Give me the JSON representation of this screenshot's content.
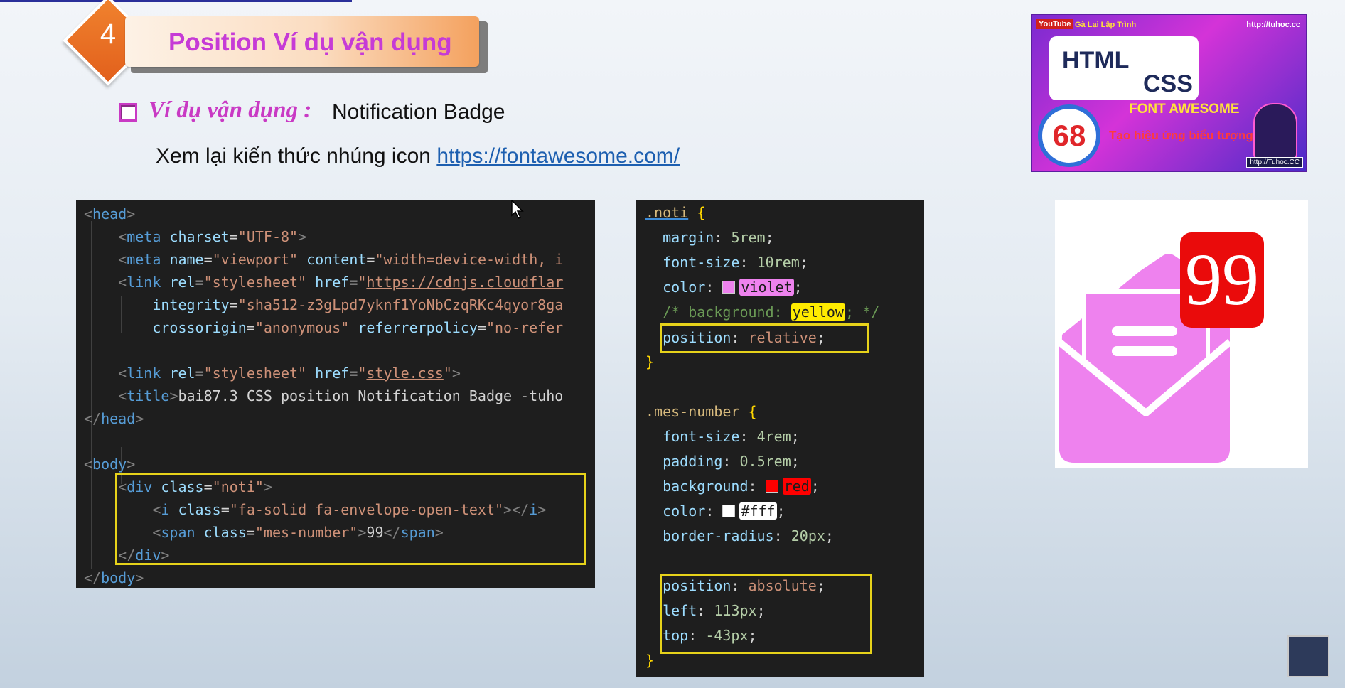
{
  "slide": {
    "number": "4",
    "title": "Position Ví dụ vận dụng",
    "example_label": "Ví dụ vận dụng :",
    "example_value": "Notification Badge",
    "review_text": "Xem lại kiến thức nhúng icon",
    "review_link": "https://fontawesome.com/"
  },
  "thumbnail": {
    "youtube_label": "YouTube",
    "channel_label": "Gà Lại Lập Trình",
    "url_top": "http://tuhoc.cc",
    "html_label": "HTML",
    "css_label": "CSS",
    "episode": "68",
    "fa_title": "FONT AWESOME",
    "subtitle": "Tạo hiệu ứng biểu tượng đẹp",
    "url_bottom": "http://Tuhoc.CC"
  },
  "html_code": {
    "lines": [
      "<head>",
      "    <meta charset=\"UTF-8\">",
      "    <meta name=\"viewport\" content=\"width=device-width, i",
      "    <link rel=\"stylesheet\" href=\"https://cdnjs.cloudflar",
      "        integrity=\"sha512-z3gLpd7yknf1YoNbCzqRKc4qyor8ga",
      "        crossorigin=\"anonymous\" referrerpolicy=\"no-refer",
      "",
      "    <link rel=\"stylesheet\" href=\"style.css\">",
      "    <title>bai87.3 CSS position Notification Badge -tuhc",
      "</head>",
      "",
      "<body>",
      "    <div class=\"noti\">",
      "        <i class=\"fa-solid fa-envelope-open-text\"></i>",
      "        <span class=\"mes-number\">99</span>",
      "    </div>",
      "</body>"
    ]
  },
  "css_code": {
    "lines": [
      ".noti {",
      "  margin: 5rem;",
      "  font-size: 10rem;",
      "  color: violet;",
      "  /* background: yellow; */",
      "  position: relative;",
      "}",
      "",
      ".mes-number {",
      "  font-size: 4rem;",
      "  padding: 0.5rem;",
      "  background: red;",
      "  color: #fff;",
      "  border-radius: 20px;",
      "",
      "  position: absolute;",
      "  left: 113px;",
      "  top: -43px;",
      "}"
    ]
  },
  "preview": {
    "badge_number": "99",
    "icon": "envelope-open-text-icon",
    "icon_color": "#ee82ee",
    "badge_color": "#ea0b0b"
  },
  "colors": {
    "accent_orange": "#e9712a",
    "title_magenta": "#c63bd6",
    "highlight_yellow": "#e6d21a",
    "code_bg": "#1e1e1e"
  }
}
